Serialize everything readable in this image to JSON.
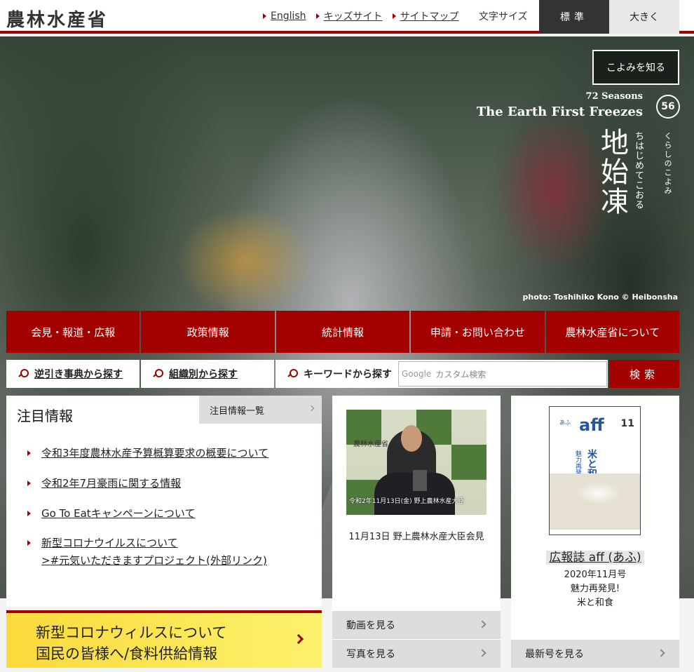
{
  "header": {
    "logo": "農林水産省",
    "links": [
      {
        "label": "English"
      },
      {
        "label": "キッズサイト"
      },
      {
        "label": "サイトマップ"
      }
    ],
    "font_size_label": "文字サイズ",
    "font_standard": "標準",
    "font_large": "大きく"
  },
  "hero": {
    "koyomi_button": "こよみを知る",
    "season_small": "72 Seasons",
    "season_en": "The Earth First Freezes",
    "season_number": "56",
    "season_kanji": "地始凍",
    "season_reading": "ちはじめてこおる",
    "kurashi": "くらしのこよみ",
    "photo_credit": "photo: Toshihiko Kono © Heibonsha"
  },
  "main_nav": [
    {
      "label": "会見・報道・広報"
    },
    {
      "label": "政策情報"
    },
    {
      "label": "統計情報"
    },
    {
      "label": "申請・お問い合わせ"
    },
    {
      "label": "農林水産省について"
    }
  ],
  "search": {
    "by_index": "逆引き事典から探す",
    "by_org": "組織別から探す",
    "by_keyword": "キーワードから探す",
    "google_logo": "Google",
    "placeholder": "カスタム検索",
    "button": "検索"
  },
  "featured": {
    "title": "注目情報",
    "more": "注目情報一覧",
    "items": [
      {
        "text": "令和3年度農林水産予算概算要求の概要について"
      },
      {
        "text": "令和2年7月豪雨に関する情報"
      },
      {
        "text": "Go To Eatキャンペーンについて"
      },
      {
        "text": "新型コロナウイルスについて",
        "sub": ">#元気いただきますプロジェクト(外部リンク)"
      }
    ]
  },
  "covid_banner": {
    "line1": "新型コロナウィルスについて",
    "line2": "国民の皆様へ/食料供給情報"
  },
  "press": {
    "photo_sign": "農林水産省",
    "photo_caption": "令和2年11月13日(金) 野上農林水産大臣",
    "text": "11月13日 野上農林水産大臣会見",
    "video": "動画を見る",
    "photos": "写真を見る"
  },
  "aff": {
    "cover_brand": "aff",
    "cover_brand_small": "あふ",
    "cover_issue": "11",
    "cover_topic1": "魅力再発見!",
    "cover_topic2": "米と和食",
    "title": "広報誌 aff (あふ)",
    "issue": "2020年11月号",
    "topic1": "魅力再発見!",
    "topic2": "米と和食",
    "latest": "最新号を見る"
  },
  "colors": {
    "brand_red": "#a30000",
    "banner_yellow": "#fbd93b"
  }
}
